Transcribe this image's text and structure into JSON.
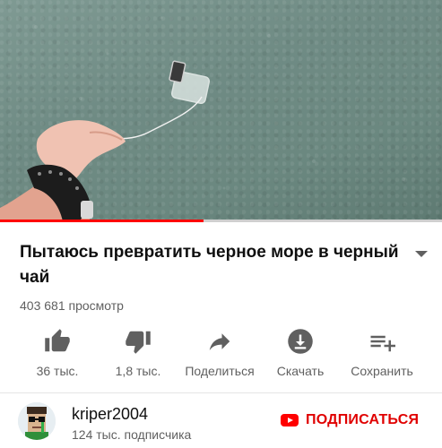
{
  "video": {
    "progress_percent": 46
  },
  "title": "Пытаюсь превратить черное море в черный чай",
  "views": "403 681 просмотр",
  "actions": [
    {
      "icon": "thumbs-up-icon",
      "label": "36 тыс."
    },
    {
      "icon": "thumbs-down-icon",
      "label": "1,8 тыс."
    },
    {
      "icon": "share-icon",
      "label": "Поделиться"
    },
    {
      "icon": "download-icon",
      "label": "Скачать"
    },
    {
      "icon": "playlist-add-icon",
      "label": "Сохранить"
    }
  ],
  "channel": {
    "name": "kriper2004",
    "subscribers": "124 тыс. подписчика",
    "subscribe_label": "ПОДПИСАТЬСЯ"
  },
  "colors": {
    "accent": "#ff0000",
    "icon": "#606060",
    "text_secondary": "#606060"
  }
}
